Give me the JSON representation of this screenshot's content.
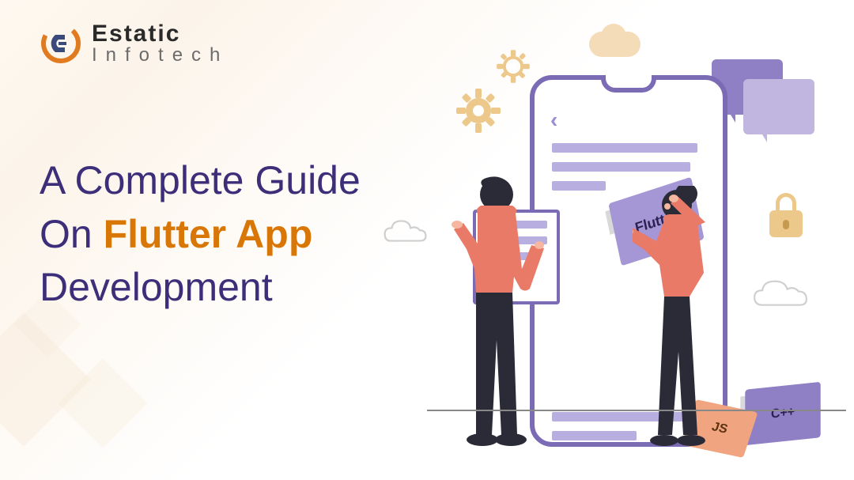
{
  "logo": {
    "line1": "Estatic",
    "line2": "Infotech"
  },
  "headline": {
    "part1": "A Complete Guide",
    "part2": "On ",
    "accent": "Flutter App",
    "part3": "Development"
  },
  "illustration": {
    "tiles": {
      "flutter": "Flutter",
      "js": "JS",
      "cpp": "C++"
    }
  }
}
